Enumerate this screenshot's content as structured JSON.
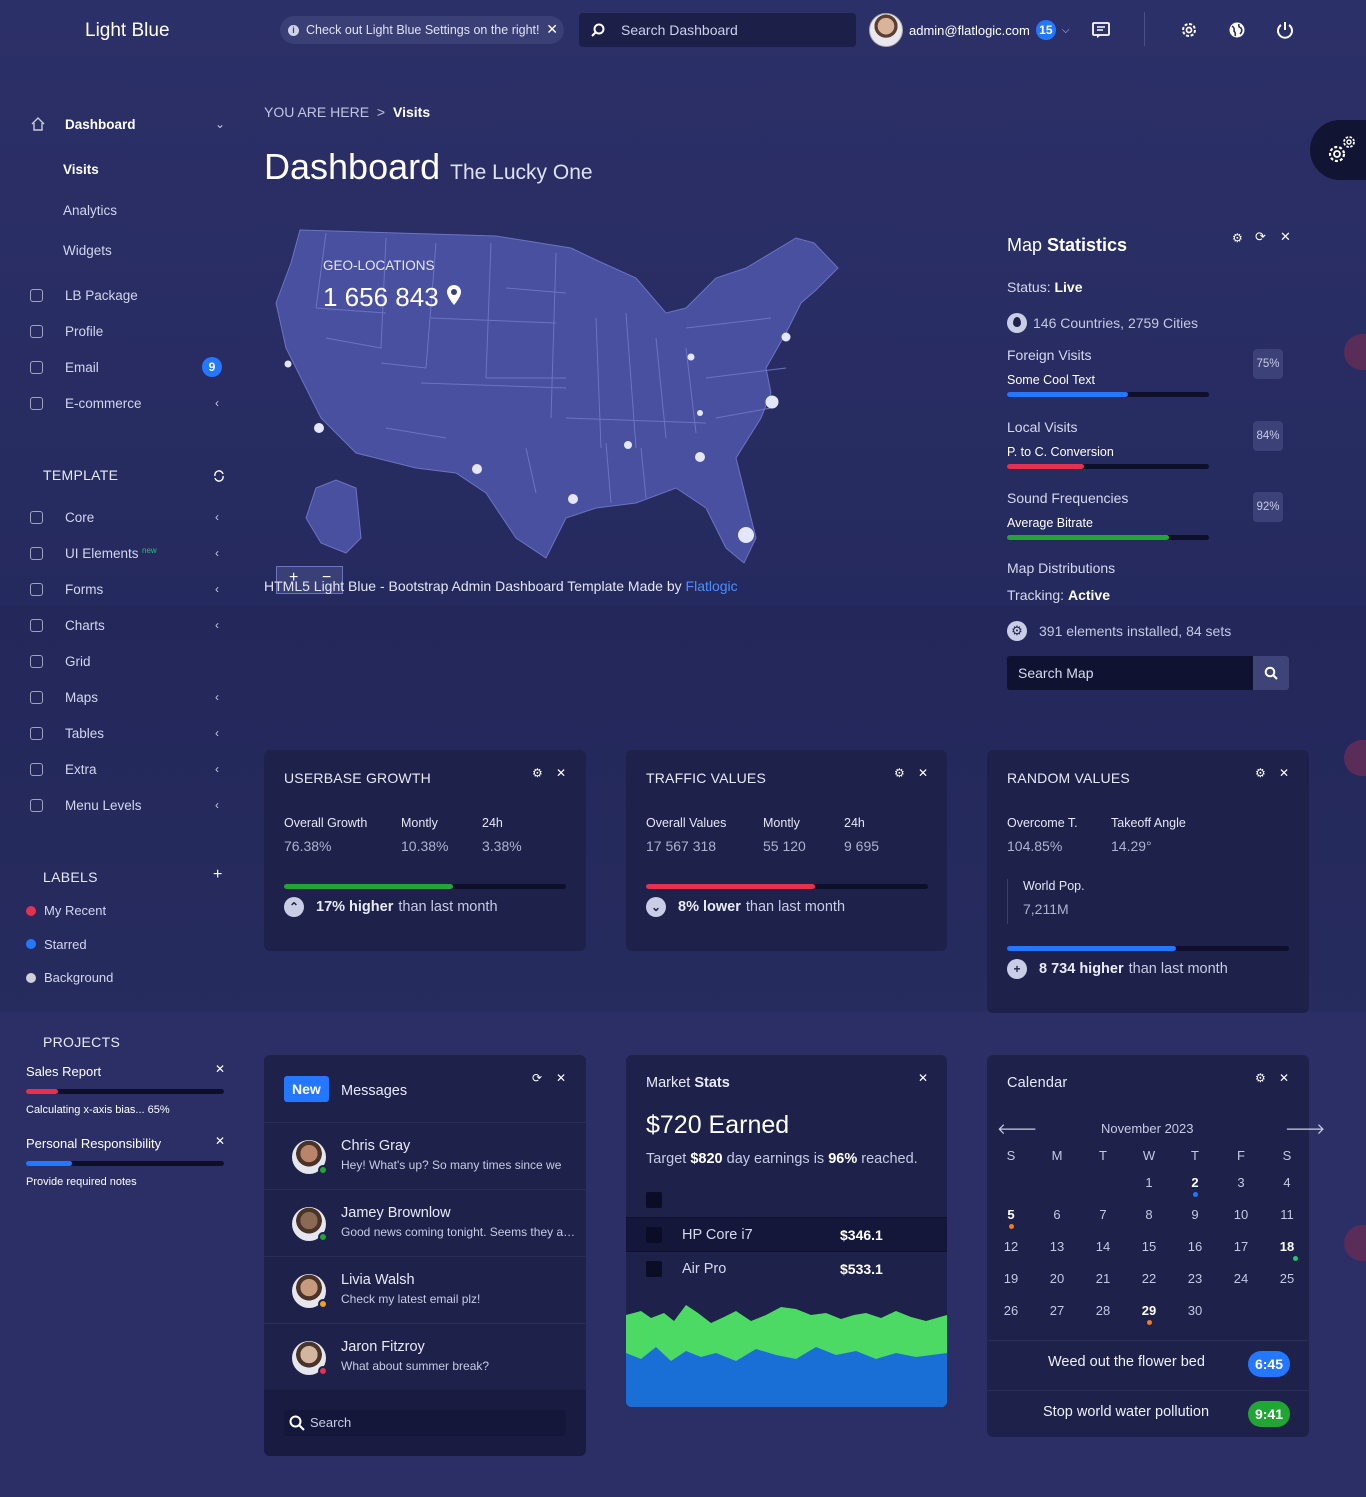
{
  "header": {
    "logo": "Light Blue",
    "notice": "Check out Light Blue Settings on the right!",
    "search_placeholder": "Search Dashboard",
    "user_email": "admin@flatlogic.com",
    "user_badge": "15"
  },
  "sidebar": {
    "dashboard": "Dashboard",
    "sub": [
      "Visits",
      "Analytics",
      "Widgets"
    ],
    "main": [
      {
        "label": "LB Package",
        "icon": "database-icon"
      },
      {
        "label": "Profile",
        "icon": "user-icon"
      },
      {
        "label": "Email",
        "icon": "paper-plane-icon",
        "badge": "9"
      },
      {
        "label": "E-commerce",
        "icon": "diamond-icon"
      }
    ],
    "template_title": "TEMPLATE",
    "template": [
      {
        "label": "Core",
        "icon": "tools-icon"
      },
      {
        "label": "UI Elements",
        "icon": "layers-icon",
        "tag": "new"
      },
      {
        "label": "Forms",
        "icon": "form-icon"
      },
      {
        "label": "Charts",
        "icon": "chart-icon"
      },
      {
        "label": "Grid",
        "icon": "grid-icon"
      },
      {
        "label": "Maps",
        "icon": "map-icon"
      },
      {
        "label": "Tables",
        "icon": "table-icon"
      },
      {
        "label": "Extra",
        "icon": "star-icon"
      },
      {
        "label": "Menu Levels",
        "icon": "folder-icon"
      }
    ],
    "labels_title": "LABELS",
    "labels": [
      {
        "label": "My Recent",
        "color": "#e5304f"
      },
      {
        "label": "Starred",
        "color": "#2477ff"
      },
      {
        "label": "Background",
        "color": "#d0d0d8"
      }
    ],
    "projects_title": "PROJECTS",
    "projects": [
      {
        "name": "Sales Report",
        "note": "Calculating x-axis bias... 65%",
        "progress": 0.16,
        "color": "#e5304f"
      },
      {
        "name": "Personal Responsibility",
        "note": "Provide required notes",
        "progress": 0.23,
        "color": "#2477ff"
      }
    ]
  },
  "breadcrumb": {
    "prefix": "YOU ARE HERE",
    "sep": ">",
    "current": "Visits"
  },
  "page": {
    "title": "Dashboard",
    "subtitle": "The Lucky One"
  },
  "map": {
    "geo_label": "GEO-LOCATIONS",
    "geo_value": "1 656 843",
    "footer_prefix": "HTML5 Light Blue - Bootstrap Admin Dashboard Template Made by",
    "footer_link": "Flatlogic"
  },
  "map_stats": {
    "title_a": "Map",
    "title_b": "Statistics",
    "status_label": "Status:",
    "status": "Live",
    "countries": "146 Countries, 2759 Cities",
    "rows": [
      {
        "title": "Foreign Visits",
        "sub": "Some Cool Text",
        "pct": "75%",
        "progress": 0.6,
        "color": "#2477ff"
      },
      {
        "title": "Local Visits",
        "sub": "P. to C. Conversion",
        "pct": "84%",
        "progress": 0.38,
        "color": "#e5304f"
      },
      {
        "title": "Sound Frequencies",
        "sub": "Average Bitrate",
        "pct": "92%",
        "progress": 0.8,
        "color": "#21a636"
      }
    ],
    "dist": "Map Distributions",
    "tracking_label": "Tracking:",
    "tracking": "Active",
    "elements": "391 elements installed, 84 sets",
    "search_placeholder": "Search Map"
  },
  "userbase": {
    "title": "USERBASE GROWTH",
    "cols": [
      {
        "k": "Overall Growth",
        "v": "76.38%"
      },
      {
        "k": "Montly",
        "v": "10.38%"
      },
      {
        "k": "24h",
        "v": "3.38%"
      }
    ],
    "progress": 0.6,
    "bold": "17% higher",
    "rest": "than last month"
  },
  "traffic": {
    "title": "TRAFFIC VALUES",
    "cols": [
      {
        "k": "Overall Values",
        "v": "17 567 318"
      },
      {
        "k": "Montly",
        "v": "55 120"
      },
      {
        "k": "24h",
        "v": "9 695"
      }
    ],
    "progress": 0.6,
    "bold": "8% lower",
    "rest": "than last month"
  },
  "random": {
    "title": "RANDOM VALUES",
    "cols": [
      {
        "k": "Overcome T.",
        "v": "104.85%"
      },
      {
        "k": "Takeoff Angle",
        "v": "14.29°"
      },
      {
        "k": "World Pop.",
        "v": "7,211M"
      }
    ],
    "progress": 0.6,
    "bold": "8 734 higher",
    "rest": "than last month"
  },
  "messages": {
    "badge": "New",
    "title": "Messages",
    "items": [
      {
        "name": "Chris Gray",
        "text": "Hey! What's up? So many times since we",
        "status": "#21a636"
      },
      {
        "name": "Jamey Brownlow",
        "text": "Good news coming tonight. Seems they agreed to proceed",
        "status": "#21a636"
      },
      {
        "name": "Livia Walsh",
        "text": "Check my latest email plz!",
        "status": "#f0a020"
      },
      {
        "name": "Jaron Fitzroy",
        "text": "What about summer break?",
        "status": "#e5304f"
      }
    ],
    "search": "Search"
  },
  "market": {
    "title_a": "Market",
    "title_b": "Stats",
    "earned": "$720 Earned",
    "target_a": "Target",
    "target_b": "$820",
    "target_c": "day earnings is",
    "target_d": "96%",
    "target_e": "reached.",
    "rows": [
      {
        "name": "HP Core i7",
        "value": "$346.1"
      },
      {
        "name": "Air Pro",
        "value": "$533.1"
      }
    ]
  },
  "calendar": {
    "title": "Calendar",
    "month": "November 2023",
    "weekdays": [
      "S",
      "M",
      "T",
      "W",
      "T",
      "F",
      "S"
    ],
    "weeks": [
      [
        "",
        "",
        "",
        "1",
        "2",
        "3",
        "4"
      ],
      [
        "5",
        "6",
        "7",
        "8",
        "9",
        "10",
        "11"
      ],
      [
        "12",
        "13",
        "14",
        "15",
        "16",
        "17",
        "18"
      ],
      [
        "19",
        "20",
        "21",
        "22",
        "23",
        "24",
        "25"
      ],
      [
        "26",
        "27",
        "28",
        "29",
        "30",
        "",
        ""
      ]
    ],
    "events": [
      {
        "text": "Weed out the flower bed",
        "time": "6:45",
        "color": "#2477ff"
      },
      {
        "text": "Stop world water pollution",
        "time": "9:41",
        "color": "#21a636"
      }
    ]
  }
}
